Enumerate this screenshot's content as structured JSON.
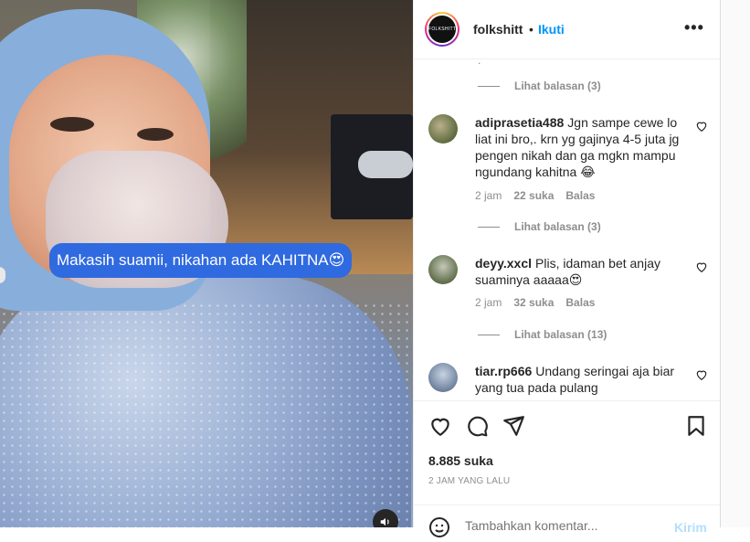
{
  "media": {
    "caption_text": "Makasih suamii, nikahan ada KAHITNA😍",
    "sound_icon": "volume-icon"
  },
  "header": {
    "avatar_text": "FOLKSHITT",
    "username": "folkshitt",
    "separator": "•",
    "follow_label": "Ikuti",
    "more_label": "•••"
  },
  "comments": {
    "stub": ".",
    "items": [
      {
        "replies_label": "Lihat balasan (3)"
      },
      {
        "username": "adiprasetia488",
        "text": "Jgn sampe cewe lo liat ini bro,. krn yg gajinya 4-5 juta jg pengen nikah dan ga mgkn mampu ngundang kahitna 😂",
        "time": "2 jam",
        "likes": "22 suka",
        "reply_label": "Balas",
        "replies_label": "Lihat balasan (3)"
      },
      {
        "username": "deyy.xxcl",
        "text": "Plis, idaman bet anjay suaminya aaaaa😍",
        "time": "2 jam",
        "likes": "32 suka",
        "reply_label": "Balas",
        "replies_label": "Lihat balasan (13)"
      },
      {
        "username": "tiar.rp666",
        "text": "Undang seringai aja biar yang tua pada pulang"
      }
    ]
  },
  "actions": {
    "likes": "8.885 suka",
    "time_ago": "2 JAM YANG LALU"
  },
  "add_comment": {
    "placeholder": "Tambahkan komentar...",
    "post_label": "Kirim"
  },
  "colors": {
    "link_blue": "#0095f6",
    "caption_blue": "#2f6ae0",
    "muted": "#8e8e8e"
  }
}
